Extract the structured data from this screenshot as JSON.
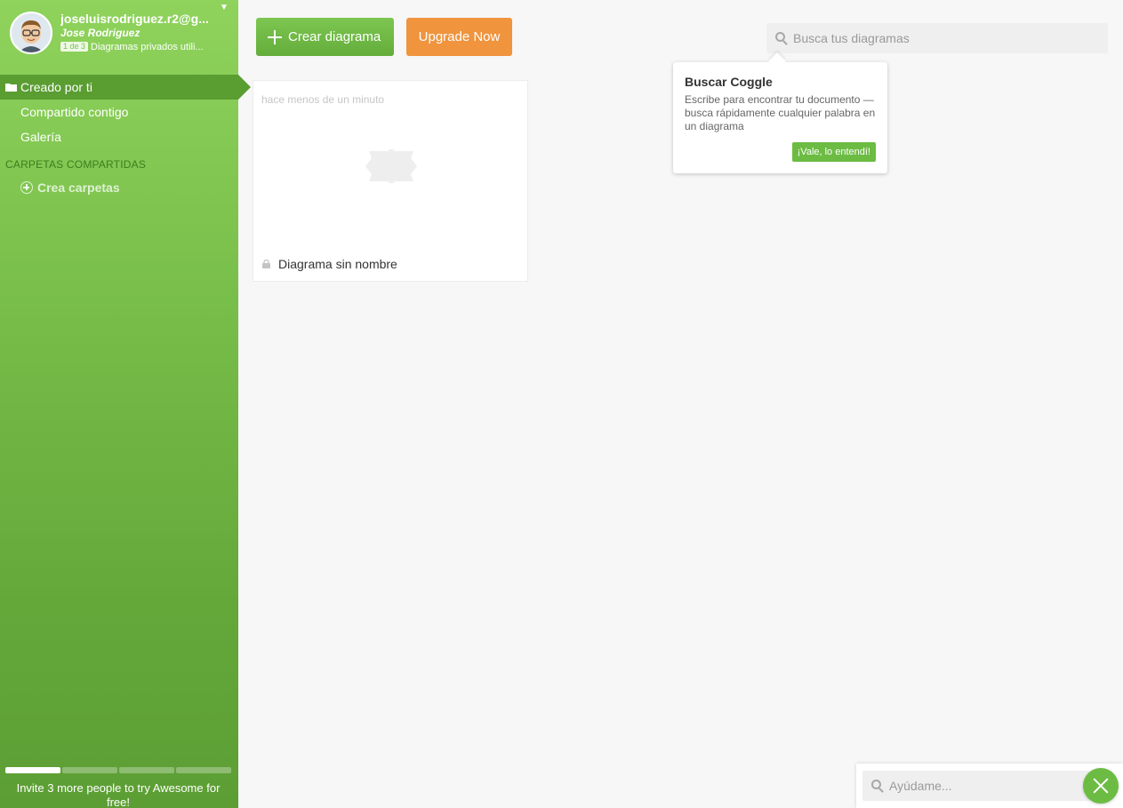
{
  "sidebar": {
    "user": {
      "email": "joseluisrodriguez.r2@g...",
      "name": "Jose Rodriguez",
      "quota_badge": "1 de 3",
      "quota_text": "Diagramas privados utili...",
      "avatar_icon": "avatar-icon"
    },
    "nav": [
      {
        "label": "Creado por ti",
        "active": true,
        "icon": "folder-icon"
      },
      {
        "label": "Compartido contigo",
        "active": false
      },
      {
        "label": "Galería",
        "active": false
      }
    ],
    "shared_folders_label": "CARPETAS COMPARTIDAS",
    "create_folders_label": "Crea carpetas",
    "invite_progress": {
      "filled": 1,
      "total": 4
    },
    "invite_text": "Invite 3 more people to try Awesome for free!"
  },
  "toolbar": {
    "create_label": "Crear diagrama",
    "upgrade_label": "Upgrade Now",
    "search_placeholder": "Busca tus diagramas"
  },
  "tooltip": {
    "title": "Buscar Coggle",
    "body": "Escribe para encontrar tu documento — busca rápidamente cualquier palabra en un diagrama",
    "button_label": "¡Vale, lo entendí!"
  },
  "diagrams": [
    {
      "time": "hace menos de un minuto",
      "title": "Diagrama sin nombre",
      "private": true
    }
  ],
  "help": {
    "placeholder": "Ayúdame..."
  },
  "colors": {
    "brand_green": "#7cc24d",
    "upgrade_orange": "#f0943e",
    "section_green": "#3e7d1e"
  }
}
